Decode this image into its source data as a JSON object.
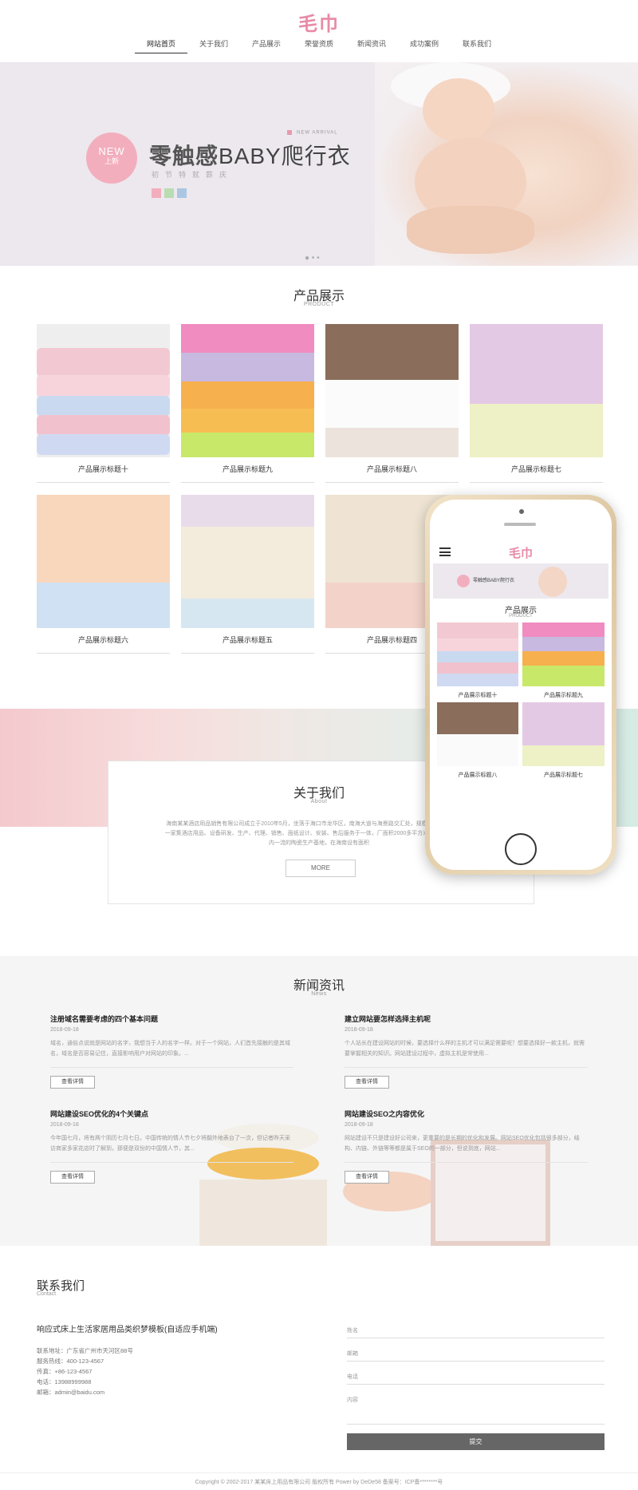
{
  "header": {
    "logo": "毛巾",
    "nav": [
      "网站首页",
      "关于我们",
      "产品展示",
      "荣誉资质",
      "新闻资讯",
      "成功案例",
      "联系我们"
    ]
  },
  "banner": {
    "badge_en": "NEW",
    "badge_cn": "上新",
    "tag": "NEW ARRIVAL",
    "title_a": "零触感",
    "title_b": "BABY爬行衣",
    "subtitle": "初节特就薪庆",
    "swatch_colors": [
      "#f3aebd",
      "#b9dcb2",
      "#aac6e2"
    ],
    "dots": "● • •"
  },
  "products": {
    "title": "产品展示",
    "subtitle": "PRODUCT",
    "items": [
      "产品展示标题十",
      "产品展示标题九",
      "产品展示标题八",
      "产品展示标题七",
      "产品展示标题六",
      "产品展示标题五",
      "产品展示标题四"
    ]
  },
  "about": {
    "title": "关于我们",
    "subtitle": "About",
    "text": "海南某某酒店用品销售有限公司成立于2010年5月，坐落于海口市龙华区，南海大道与海景路交汇处，规模较大、实力较强的一家集酒店用品、设备研发、生产、代理、销售、面纸设计、安装、售后服务于一体，厂面积2000多平方米，公司山东拥有国内一流的陶瓷生产基地，在海南设有面积",
    "more": "MORE"
  },
  "news": {
    "title": "新闻资讯",
    "subtitle": "News",
    "button": "查看详情",
    "items": [
      {
        "title": "注册域名需要考虑的四个基本问题",
        "date": "2018-09-18",
        "text": "域名，通俗点说就是网站的名字，我想当于人的名字一样。对于一个网站，人们首先接触的是其域名，域名是否容易记住，直接影响用户对网站的印象。..."
      },
      {
        "title": "建立网站要怎样选择主机呢",
        "date": "2018-09-18",
        "text": "个人站长在建设网站的时候，要选择什么样的主机才可以满足需要呢？想要选择好一款主机，就需要掌握相关的知识。网站建设过程中，虚拟主机是常使用..."
      },
      {
        "title": "网站建设SEO优化的4个关键点",
        "date": "2018-09-18",
        "text": "今年国七月，将有两个阴历七月七日。中国传统的情人节七夕将翻外地表台了一次，但记者昨天采访商家多家花店时了解到，那便是双份的中国情人节，其..."
      },
      {
        "title": "网站建设SEO之内容优化",
        "date": "2018-09-18",
        "text": "网站建设不只是建设好公司来，更重要的是长期的优化和发展。网站SEO优化包括很多部分，结构、内链、外链等等都是属于SEO的一部分，但说到底，网站..."
      }
    ]
  },
  "contact": {
    "title": "联系我们",
    "subtitle": "Contact",
    "company": "响应式床上生活家居用品类织梦模板(自适应手机端)",
    "info": [
      "联系地址：广东省广州市天河区88号",
      "服务热线：400-123-4567",
      "传真：+86-123-4567",
      "电话：13988999988",
      "邮箱：admin@baidu.com"
    ],
    "fields": [
      "姓名",
      "邮箱",
      "电话",
      "内容"
    ],
    "submit": "提交"
  },
  "footer": {
    "text": "Copyright © 2002-2017 某某床上用品有限公司 版权所有 Power by DeDe58 备案号：ICP备********号"
  },
  "phone": {
    "logo": "毛巾",
    "banner_title": "零触感BABY爬行衣",
    "section_title": "产品展示",
    "section_sub": "PRODUCT",
    "items": [
      "产品展示标题十",
      "产品展示标题九",
      "产品展示标题八",
      "产品展示标题七"
    ]
  }
}
